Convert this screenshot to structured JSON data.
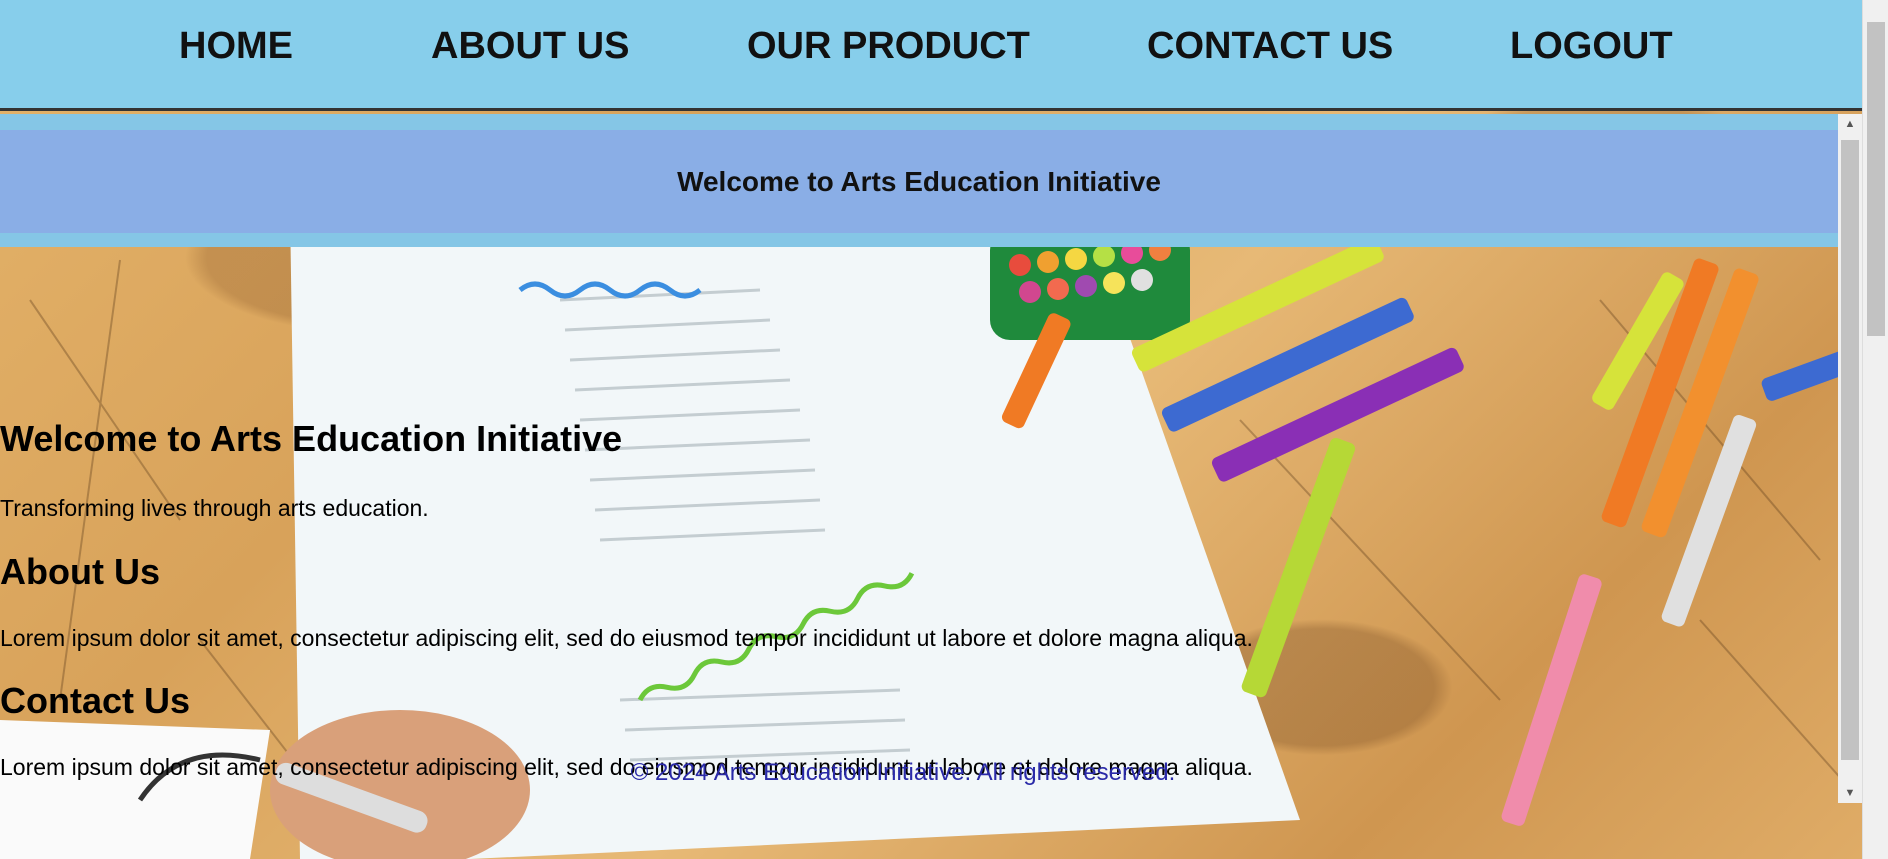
{
  "nav": {
    "items": [
      {
        "label": "HOME"
      },
      {
        "label": "ABOUT US"
      },
      {
        "label": "OUR PRODUCT"
      },
      {
        "label": "CONTACT US"
      },
      {
        "label": "LOGOUT"
      }
    ]
  },
  "banner": {
    "title": "Welcome to Arts Education Initiative"
  },
  "content": {
    "welcome_heading": "Welcome to Arts Education Initiative",
    "welcome_text": "Transforming lives through arts education.",
    "about_heading": "About Us",
    "about_text": "Lorem ipsum dolor sit amet, consectetur adipiscing elit, sed do eiusmod tempor incididunt ut labore et dolore magna aliqua.",
    "contact_heading": "Contact Us",
    "contact_text": "Lorem ipsum dolor sit amet, consectetur adipiscing elit, sed do eiusmod tempor incididunt ut labore et dolore magna aliqua."
  },
  "footer": {
    "text": "© 2024 Arts Education Initiative. All rights reserved."
  },
  "colors": {
    "nav_bg": "#87ceeb",
    "banner_bg": "#8aaee6",
    "footer_text": "#2a2aa8"
  }
}
